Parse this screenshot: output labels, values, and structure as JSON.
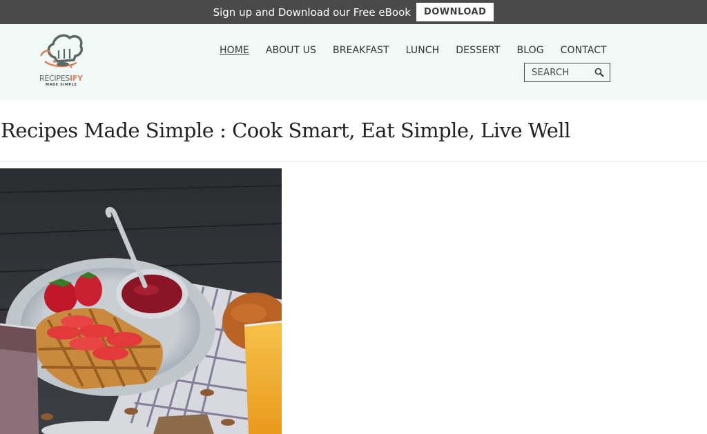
{
  "promo": {
    "text": "Sign up and Download our Free eBook",
    "button_label": "DOWNLOAD"
  },
  "logo": {
    "word_part1": "RECIPES",
    "word_part2": "IFY",
    "tagline": "MADE SIMPLE"
  },
  "nav": {
    "items": [
      {
        "label": "HOME",
        "active": true
      },
      {
        "label": "ABOUT US"
      },
      {
        "label": "BREAKFAST"
      },
      {
        "label": "LUNCH"
      },
      {
        "label": "DESSERT"
      },
      {
        "label": "BLOG"
      },
      {
        "label": "CONTACT"
      }
    ]
  },
  "search": {
    "placeholder": "SEARCH",
    "icon": "search-icon"
  },
  "main": {
    "title": "Recipes Made Simple : Cook Smart, Eat Simple, Live Well"
  },
  "colors": {
    "promo_bg": "#4a4a4a",
    "header_bg": "#f1f9f6",
    "logo_accent": "#e0805c",
    "logo_gray": "#5b6660"
  }
}
